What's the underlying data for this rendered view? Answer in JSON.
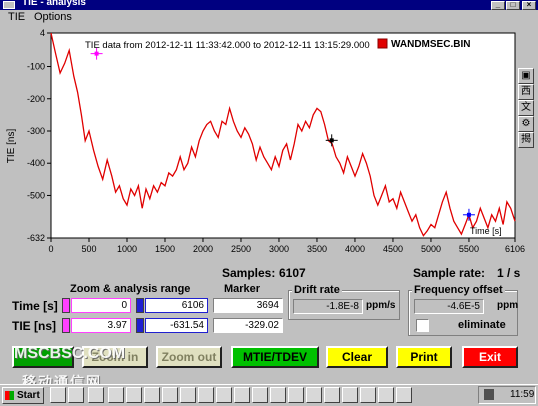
{
  "window": {
    "title": "TIE - analysis",
    "controls": [
      "_",
      "□",
      "×"
    ]
  },
  "menu": [
    {
      "label": "TIE"
    },
    {
      "label": "Options"
    }
  ],
  "chart_data": {
    "type": "line",
    "title": "TIE data from 2012-12-11 11:33:42.000  to  2012-12-11 13:15:29.000",
    "legend": "WANDMSEC.BIN",
    "legend_placement": "top-right",
    "xlabel": "Time [s]",
    "ylabel": "TIE [ns]",
    "xlim": [
      0,
      6106
    ],
    "ylim": [
      -632,
      4
    ],
    "x_ticks": [
      0,
      500,
      1000,
      1500,
      2000,
      2500,
      3000,
      3500,
      4000,
      4500,
      5000,
      5500,
      6106
    ],
    "y_ticks": [
      4,
      -100,
      -200,
      -300,
      -400,
      -500,
      -632
    ],
    "grid": false,
    "series_color": "#e00000",
    "series": [
      {
        "x": [
          0,
          60,
          120,
          180,
          240,
          300,
          350,
          400,
          450,
          500,
          560,
          620,
          680,
          740,
          800,
          850,
          900,
          950,
          1000,
          1050,
          1100,
          1150,
          1200,
          1250,
          1300,
          1350,
          1400,
          1450,
          1500,
          1550,
          1600,
          1650,
          1700,
          1750,
          1800,
          1850,
          1900,
          1950,
          2000,
          2050,
          2100,
          2150,
          2200,
          2250,
          2300,
          2350,
          2400,
          2450,
          2500,
          2550,
          2600,
          2650,
          2700,
          2750,
          2800,
          2850,
          2900,
          2950,
          3000,
          3050,
          3100,
          3150,
          3200,
          3250,
          3300,
          3350,
          3400,
          3450,
          3500,
          3550,
          3600,
          3650,
          3700,
          3750,
          3800,
          3850,
          3900,
          3950,
          4000,
          4050,
          4100,
          4150,
          4200,
          4250,
          4300,
          4350,
          4400,
          4450,
          4500,
          4550,
          4600,
          4650,
          4700,
          4750,
          4800,
          4850,
          4900,
          4950,
          5000,
          5050,
          5100,
          5150,
          5200,
          5250,
          5300,
          5350,
          5400,
          5450,
          5500,
          5550,
          5600,
          5650,
          5700,
          5750,
          5800,
          5850,
          5900,
          5950,
          6000,
          6050,
          6106
        ],
        "y": [
          4,
          -60,
          -120,
          -90,
          -50,
          -130,
          -180,
          -250,
          -330,
          -300,
          -360,
          -410,
          -450,
          -390,
          -440,
          -490,
          -470,
          -510,
          -530,
          -480,
          -500,
          -470,
          -540,
          -480,
          -510,
          -470,
          -490,
          -460,
          -470,
          -430,
          -440,
          -420,
          -380,
          -420,
          -400,
          -350,
          -380,
          -330,
          -300,
          -280,
          -270,
          -300,
          -320,
          -270,
          -280,
          -230,
          -270,
          -300,
          -320,
          -290,
          -310,
          -340,
          -390,
          -350,
          -380,
          -400,
          -420,
          -380,
          -410,
          -360,
          -340,
          -390,
          -340,
          -280,
          -300,
          -270,
          -290,
          -250,
          -230,
          -240,
          -280,
          -330,
          -340,
          -380,
          -400,
          -430,
          -380,
          -410,
          -440,
          -410,
          -370,
          -400,
          -440,
          -500,
          -530,
          -500,
          -470,
          -520,
          -510,
          -540,
          -490,
          -520,
          -550,
          -580,
          -560,
          -600,
          -625,
          -610,
          -590,
          -600,
          -560,
          -520,
          -490,
          -540,
          -580,
          -600,
          -620,
          -590,
          -560,
          -600,
          -580,
          -540,
          -570,
          -600,
          -560,
          -580,
          -540,
          -590,
          -520,
          -540,
          -580
        ]
      }
    ],
    "markers": [
      {
        "x": 600,
        "y": -60,
        "color": "#ff00ff"
      },
      {
        "x": 3694,
        "y": -329,
        "color": "#000000"
      },
      {
        "x": 5500,
        "y": -560,
        "color": "#0000ff"
      }
    ]
  },
  "side_tools": [
    {
      "icon": "chart-icon",
      "glyph": "▣"
    },
    {
      "icon": "chinese-west-icon",
      "glyph": "西"
    },
    {
      "icon": "chinese-text-icon",
      "glyph": "文"
    },
    {
      "icon": "gear-icon",
      "glyph": "⚙"
    },
    {
      "icon": "chinese-mode-icon",
      "glyph": "揭"
    }
  ],
  "info": {
    "samples_label": "Samples:",
    "samples_value": "6107",
    "rate_label": "Sample rate:",
    "rate_value": "1 / s",
    "zoom_label": "Zoom & analysis range",
    "marker_label": "Marker",
    "time_label": "Time [s]",
    "tie_label": "TIE [ns]",
    "time_from": "0",
    "time_to": "6106",
    "time_marker": "3694",
    "tie_from": "3.97",
    "tie_to": "-631.54",
    "tie_marker": "-329.02",
    "drift_title": "Drift rate",
    "drift_value": "-1.8E-8",
    "drift_unit": "ppm/s",
    "freq_title": "Frequency offset",
    "freq_value": "-4.6E-5",
    "freq_unit": "ppm",
    "eliminate_label": "eliminate"
  },
  "buttons": {
    "zoom_in": "Zoom in",
    "zoom_out": "Zoom out",
    "mtie": "MTIE/TDEV",
    "clear": "Clear",
    "print": "Print",
    "exit": "Exit"
  },
  "colors": {
    "zoom_in_bg": "#e0e0c0",
    "zoom_out_bg": "#e0e0c0",
    "mtie_bg": "#00c000",
    "clear_bg": "#ffff00",
    "print_bg": "#ffff00",
    "exit_bg": "#ff0000"
  },
  "watermark": {
    "line1": "MSCBSC.COM",
    "line2": "移动通信网"
  },
  "taskbar": {
    "start_label": "Start",
    "clock": "11:59",
    "icons": [
      "ie-icon",
      "browser-icon",
      "app-icon",
      "app-icon",
      "app-icon",
      "app-icon",
      "window-icon",
      "printer-icon",
      "perf-icon",
      "app-icon",
      "app-icon",
      "app-icon",
      "app-icon",
      "app-icon",
      "app-icon",
      "app-icon",
      "app-icon",
      "app-icon",
      "app-icon",
      "app-icon",
      "speaker-icon"
    ]
  }
}
